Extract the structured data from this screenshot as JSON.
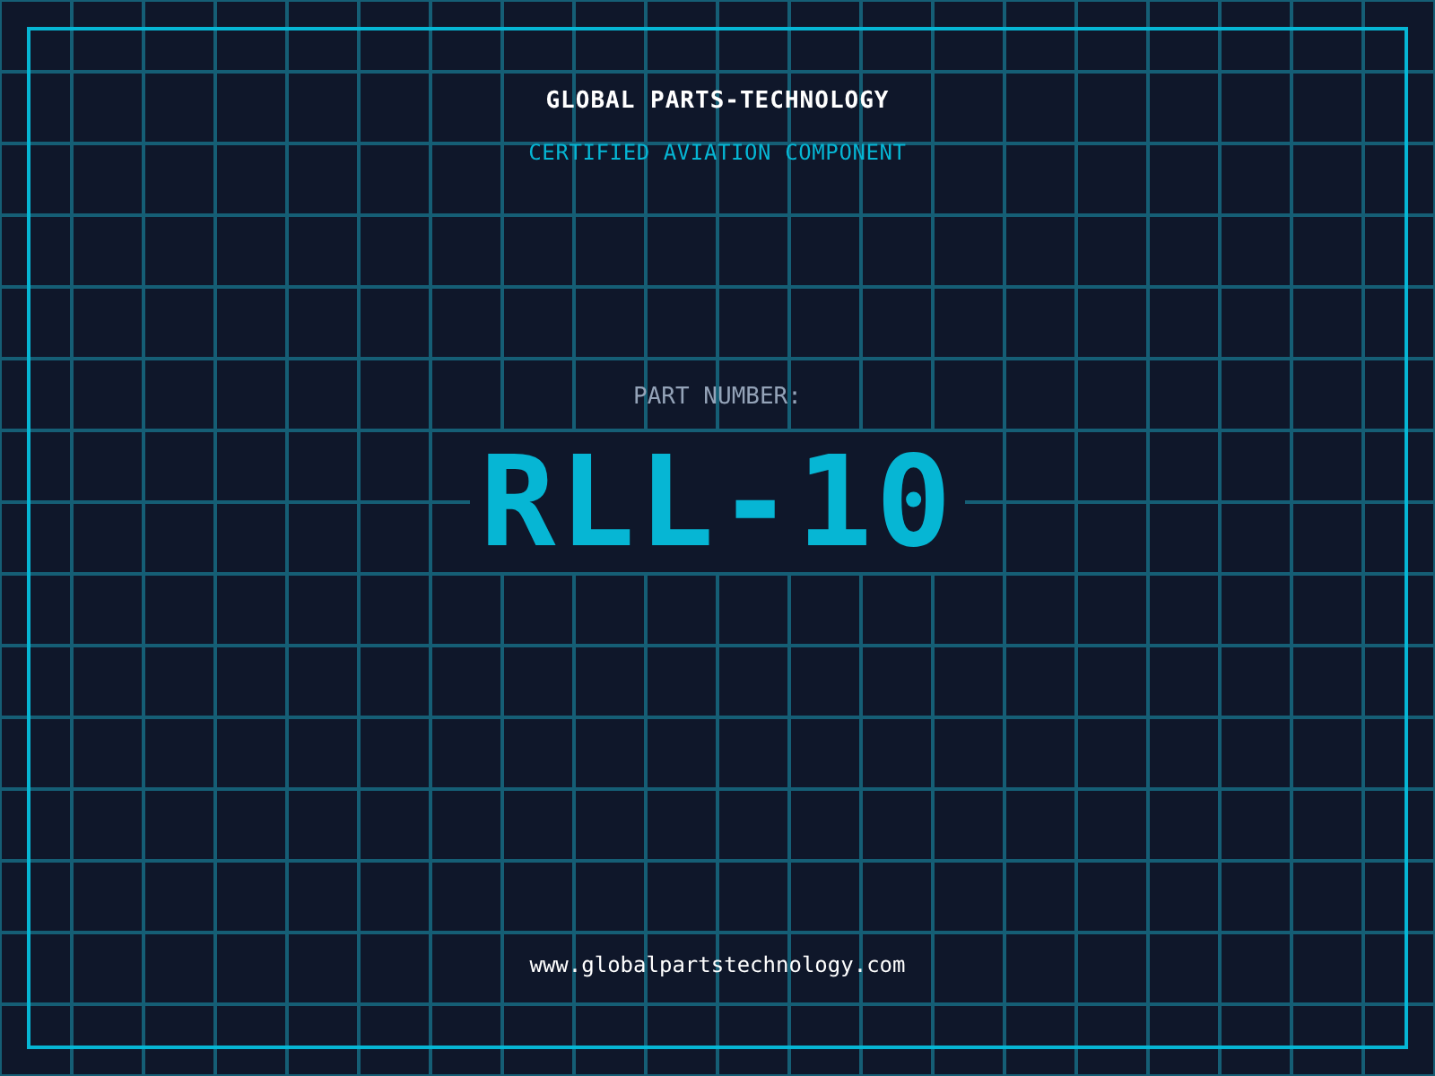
{
  "header": {
    "title": "GLOBAL PARTS-TECHNOLOGY",
    "subtitle": "CERTIFIED AVIATION COMPONENT"
  },
  "part": {
    "label": "PART NUMBER:",
    "number": "RLL-10"
  },
  "footer": {
    "url": "www.globalpartstechnology.com"
  }
}
